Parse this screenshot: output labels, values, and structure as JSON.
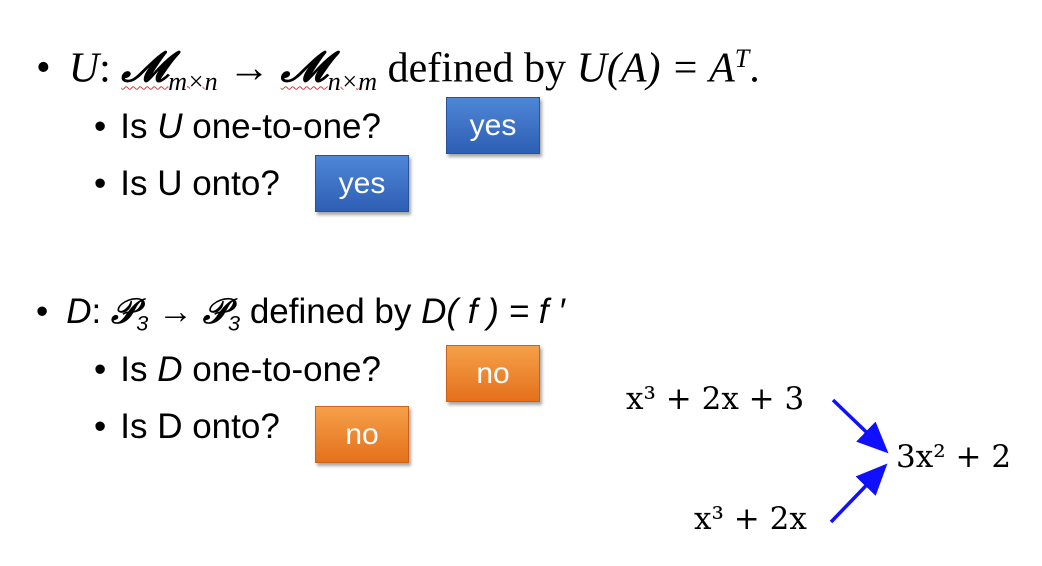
{
  "section_u": {
    "statement": {
      "bullet": "•",
      "var": "U",
      "colon": ":",
      "space_sym": "𝓜",
      "domain_sub": "m×n",
      "arrow": "→",
      "codomain_sub": "n×m",
      "defined_by": "defined by",
      "map": "U(A) = A",
      "map_sup": "T",
      "period": "."
    },
    "q1": {
      "bullet": "•",
      "pre": "Is ",
      "var": "U",
      "post": " one-to-one?"
    },
    "q2": {
      "bullet": "•",
      "text": "Is U onto?"
    },
    "answer1": "yes",
    "answer2": "yes"
  },
  "section_d": {
    "statement": {
      "bullet": "•",
      "var": "D",
      "colon": ":",
      "space_sym": "𝒫",
      "space_sub": "3",
      "arrow": "→",
      "defined_by": "defined by",
      "map": "D( f ) = f ′"
    },
    "q1": {
      "bullet": "•",
      "pre": "Is ",
      "var": "D",
      "post": " one-to-one?"
    },
    "q2": {
      "bullet": "•",
      "text": "Is D onto?"
    },
    "answer1": "no",
    "answer2": "no"
  },
  "diagram": {
    "poly_top": "x³ + 2x + 3",
    "poly_bottom": "x³ + 2x",
    "derivative": "3x² + 2"
  },
  "colors": {
    "blue_button": "#3a6fc4",
    "orange_button": "#ee7b2a",
    "arrow": "#1010ff",
    "squiggle": "#d23c3c"
  }
}
